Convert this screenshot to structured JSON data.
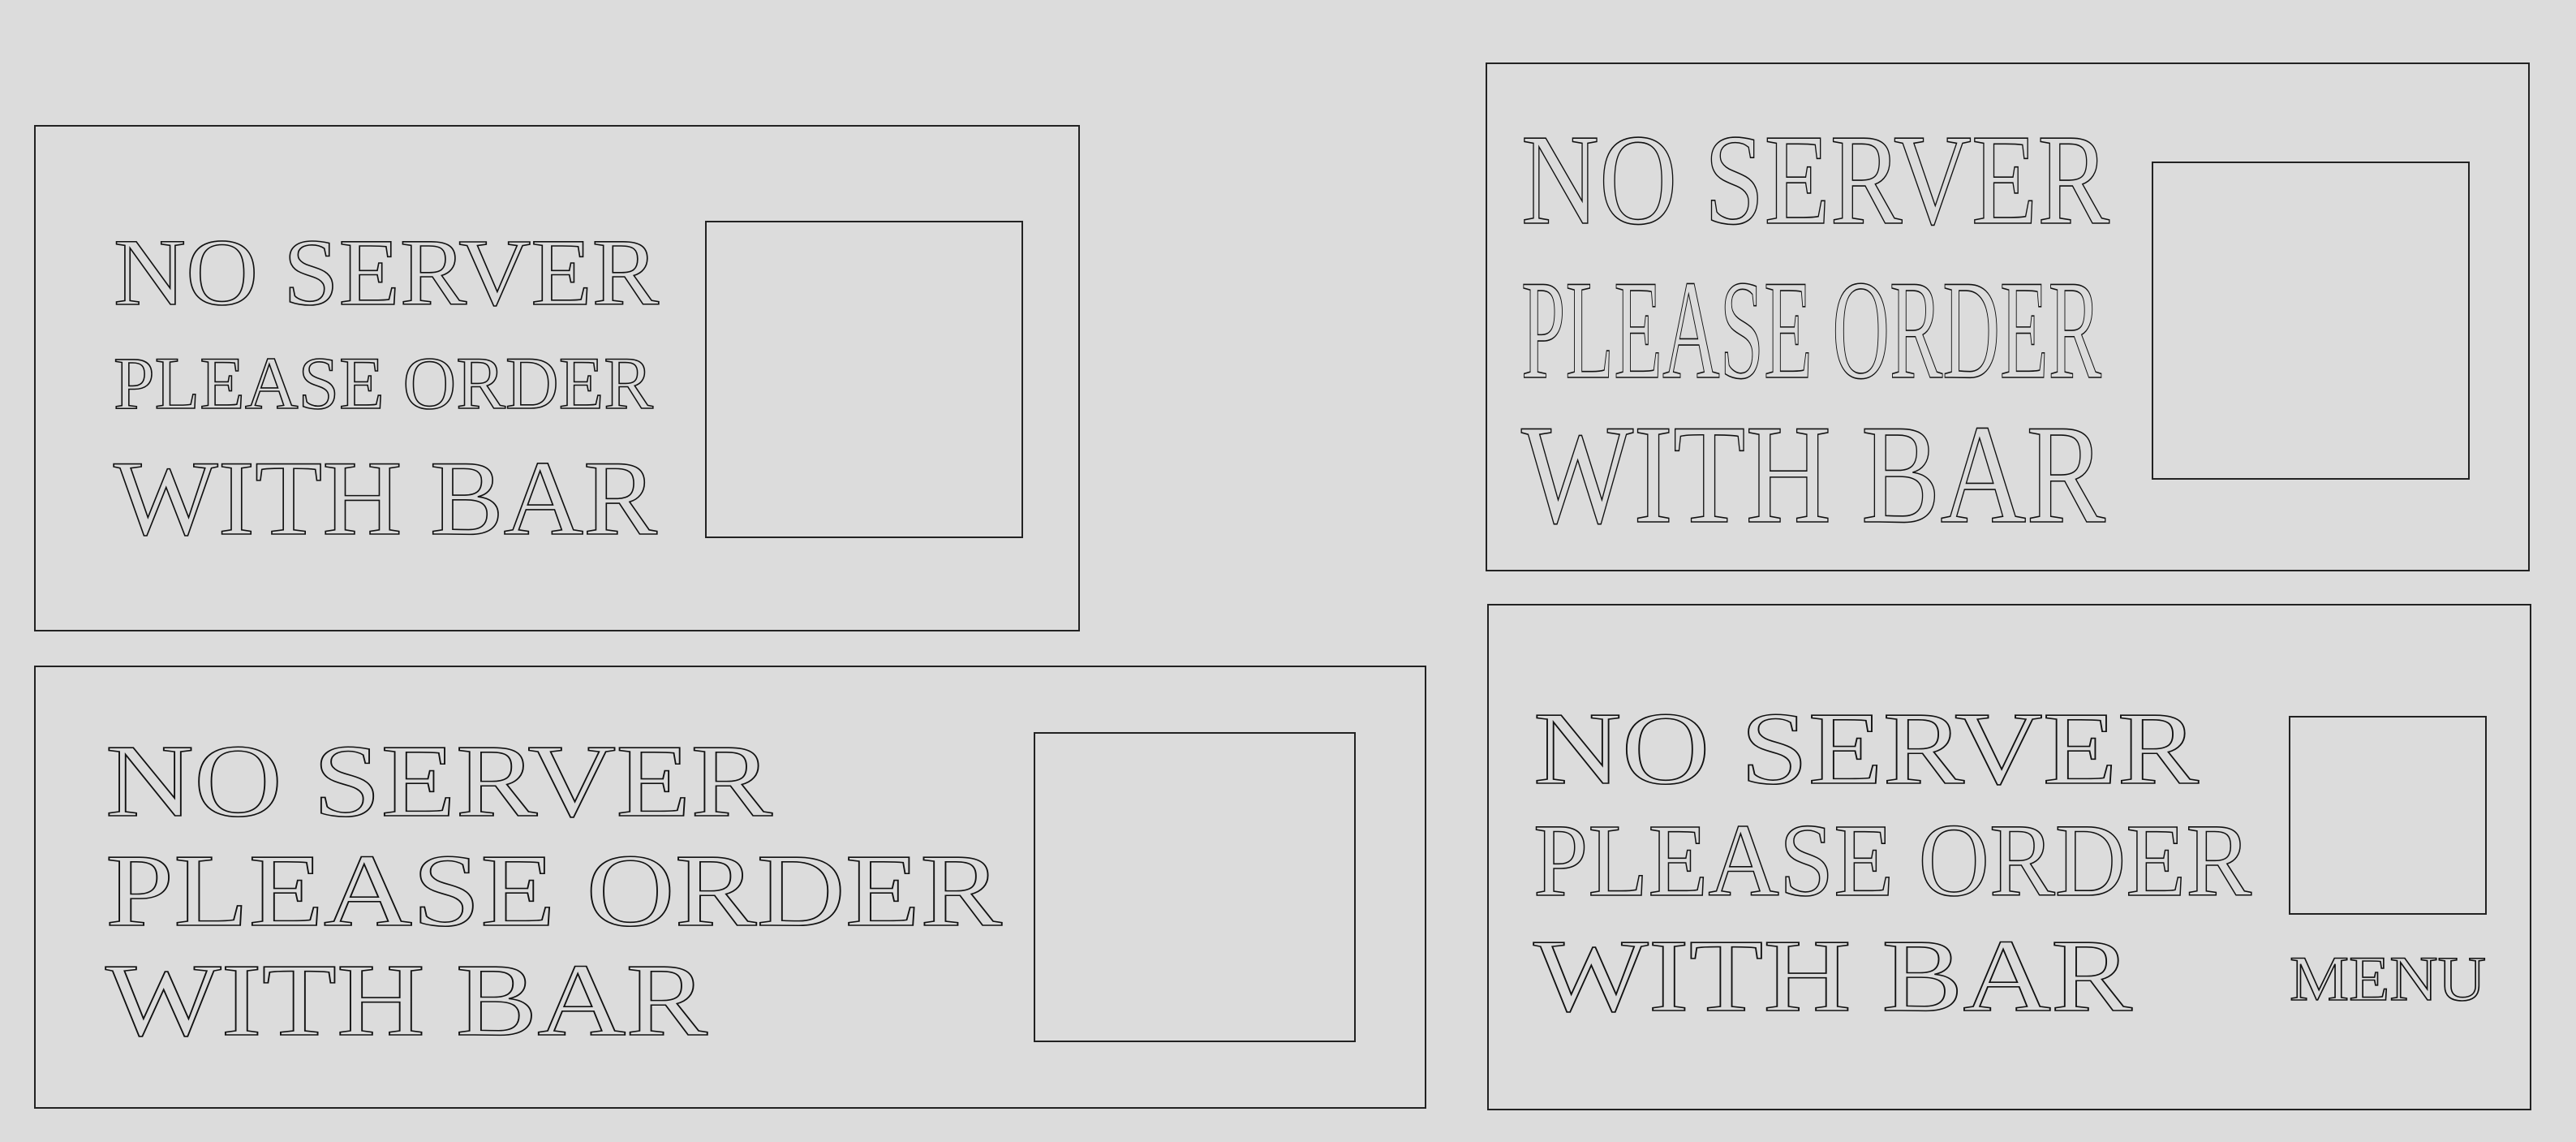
{
  "signs": [
    {
      "lines": [
        "NO SERVER",
        "PLEASE ORDER",
        "WITH BAR"
      ],
      "extra_label": ""
    },
    {
      "lines": [
        "NO SERVER",
        "PLEASE ORDER",
        "WITH BAR"
      ],
      "extra_label": ""
    },
    {
      "lines": [
        "NO SERVER",
        "PLEASE ORDER",
        "WITH BAR"
      ],
      "extra_label": ""
    },
    {
      "lines": [
        "NO SERVER",
        "PLEASE ORDER",
        "WITH BAR"
      ],
      "extra_label": "MENU"
    }
  ]
}
